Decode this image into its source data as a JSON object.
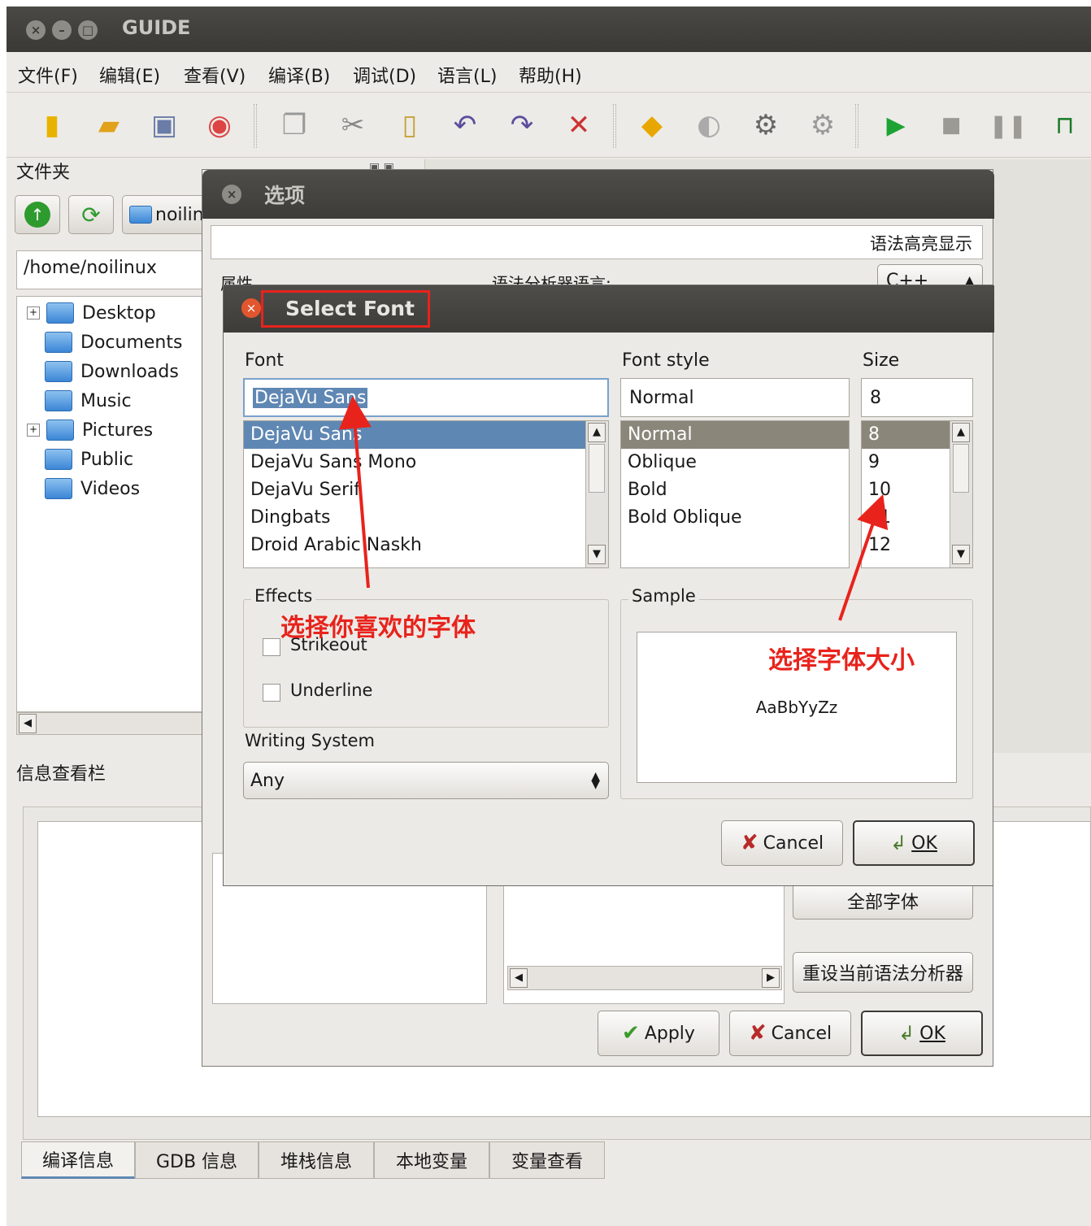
{
  "window": {
    "title": "GUIDE"
  },
  "menu": [
    "文件(F)",
    "编辑(E)",
    "查看(V)",
    "编译(B)",
    "调试(D)",
    "语言(L)",
    "帮助(H)"
  ],
  "toolbar_icons": [
    "new-file-icon",
    "open-folder-icon",
    "save-icon",
    "close-file-icon",
    "copy-icon",
    "cut-icon",
    "paste-icon",
    "undo-icon",
    "redo-icon",
    "tools-icon",
    "compile-icon",
    "rebuild-icon",
    "settings-gear-icon",
    "gear-disabled-icon",
    "run-icon",
    "stop-icon",
    "pause-icon",
    "step-icon"
  ],
  "folder_panel": {
    "title": "文件夹",
    "path_combo": "noilin",
    "path_field": "/home/noilinux",
    "tree": [
      "Desktop",
      "Documents",
      "Downloads",
      "Music",
      "Pictures",
      "Public",
      "Videos"
    ]
  },
  "info_panel": {
    "title": "信息查看栏",
    "tabs": [
      "编译信息",
      "GDB 信息",
      "堆栈信息",
      "本地变量",
      "变量查看"
    ]
  },
  "options_dialog": {
    "title": "选项",
    "section": "语法高亮显示",
    "attr_label": "属性",
    "lang_label": "语法分析器语言:",
    "lang_value": "C++",
    "all_fonts_button": "全部字体",
    "reset_button": "重设当前语法分析器",
    "apply": "Apply",
    "cancel": "Cancel",
    "ok": "OK"
  },
  "font_dialog": {
    "title": "Select Font",
    "font_label": "Font",
    "style_label": "Font style",
    "size_label": "Size",
    "font_value": "DejaVu Sans",
    "style_value": "Normal",
    "size_value": "8",
    "fonts": [
      "DejaVu Sans",
      "DejaVu Sans Mono",
      "DejaVu Serif",
      "Dingbats",
      "Droid Arabic Naskh"
    ],
    "styles": [
      "Normal",
      "Oblique",
      "Bold",
      "Bold Oblique"
    ],
    "sizes": [
      "8",
      "9",
      "10",
      "11",
      "12"
    ],
    "effects_label": "Effects",
    "strikeout": "Strikeout",
    "underline": "Underline",
    "sample_label": "Sample",
    "sample_text": "AaBbYyZz",
    "writing_system_label": "Writing System",
    "writing_system_value": "Any",
    "cancel": "Cancel",
    "ok": "OK"
  },
  "annotations": {
    "font_hint": "选择你喜欢的字体",
    "size_hint": "选择字体大小"
  },
  "colors": {
    "annotation": "#e8231c",
    "selection": "#5f87b3",
    "titlebar": "#3d3c39"
  }
}
